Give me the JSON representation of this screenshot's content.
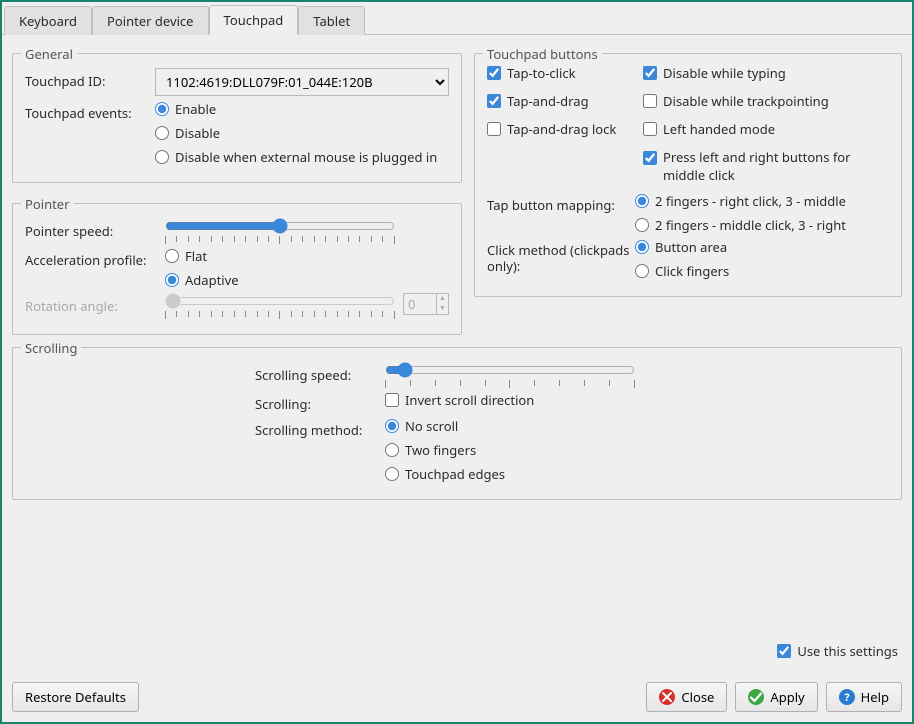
{
  "tabs": {
    "keyboard": "Keyboard",
    "pointer_device": "Pointer device",
    "touchpad": "Touchpad",
    "tablet": "Tablet"
  },
  "general": {
    "title": "General",
    "touchpad_id_label": "Touchpad ID:",
    "touchpad_id_value": "1102:4619:DLL079F:01_044E:120B",
    "touchpad_events_label": "Touchpad events:",
    "events": {
      "enable": "Enable",
      "disable": "Disable",
      "disable_ext_mouse": "Disable when external mouse is plugged in"
    },
    "events_selected": "enable"
  },
  "pointer": {
    "title": "Pointer",
    "pointer_speed_label": "Pointer speed:",
    "pointer_speed_value": 50,
    "accel_profile_label": "Acceleration profile:",
    "accel": {
      "flat": "Flat",
      "adaptive": "Adaptive"
    },
    "accel_selected": "adaptive",
    "rotation_label": "Rotation angle:",
    "rotation_value": 0,
    "rotation_enabled": false
  },
  "tp_buttons": {
    "title": "Touchpad buttons",
    "checks": {
      "tap_to_click": {
        "label": "Tap-to-click",
        "checked": true
      },
      "disable_typing": {
        "label": "Disable while typing",
        "checked": true
      },
      "tap_and_drag": {
        "label": "Tap-and-drag",
        "checked": true
      },
      "disable_trackpoint": {
        "label": "Disable while trackpointing",
        "checked": false
      },
      "tap_drag_lock": {
        "label": "Tap-and-drag lock",
        "checked": false
      },
      "left_handed": {
        "label": "Left handed mode",
        "checked": false
      },
      "middle_click": {
        "label": "Press left and right buttons for middle click",
        "checked": true
      }
    },
    "tap_map_label": "Tap button mapping:",
    "tap_map": {
      "right_middle": "2 fingers - right click, 3 - middle",
      "middle_right": "2 fingers - middle click, 3 - right"
    },
    "tap_map_selected": "right_middle",
    "click_method_label": "Click method (clickpads only):",
    "click_method": {
      "button_area": "Button area",
      "click_fingers": "Click fingers"
    },
    "click_method_selected": "button_area"
  },
  "scrolling": {
    "title": "Scrolling",
    "speed_label": "Scrolling speed:",
    "speed_value": 5,
    "scrolling_label": "Scrolling:",
    "invert_label": "Invert scroll direction",
    "invert_checked": false,
    "method_label": "Scrolling method:",
    "method": {
      "no_scroll": "No scroll",
      "two_fingers": "Two fingers",
      "edges": "Touchpad edges"
    },
    "method_selected": "no_scroll"
  },
  "use_settings": {
    "label": "Use this settings",
    "checked": true
  },
  "buttons": {
    "restore": "Restore Defaults",
    "close": "Close",
    "apply": "Apply",
    "help": "Help"
  }
}
